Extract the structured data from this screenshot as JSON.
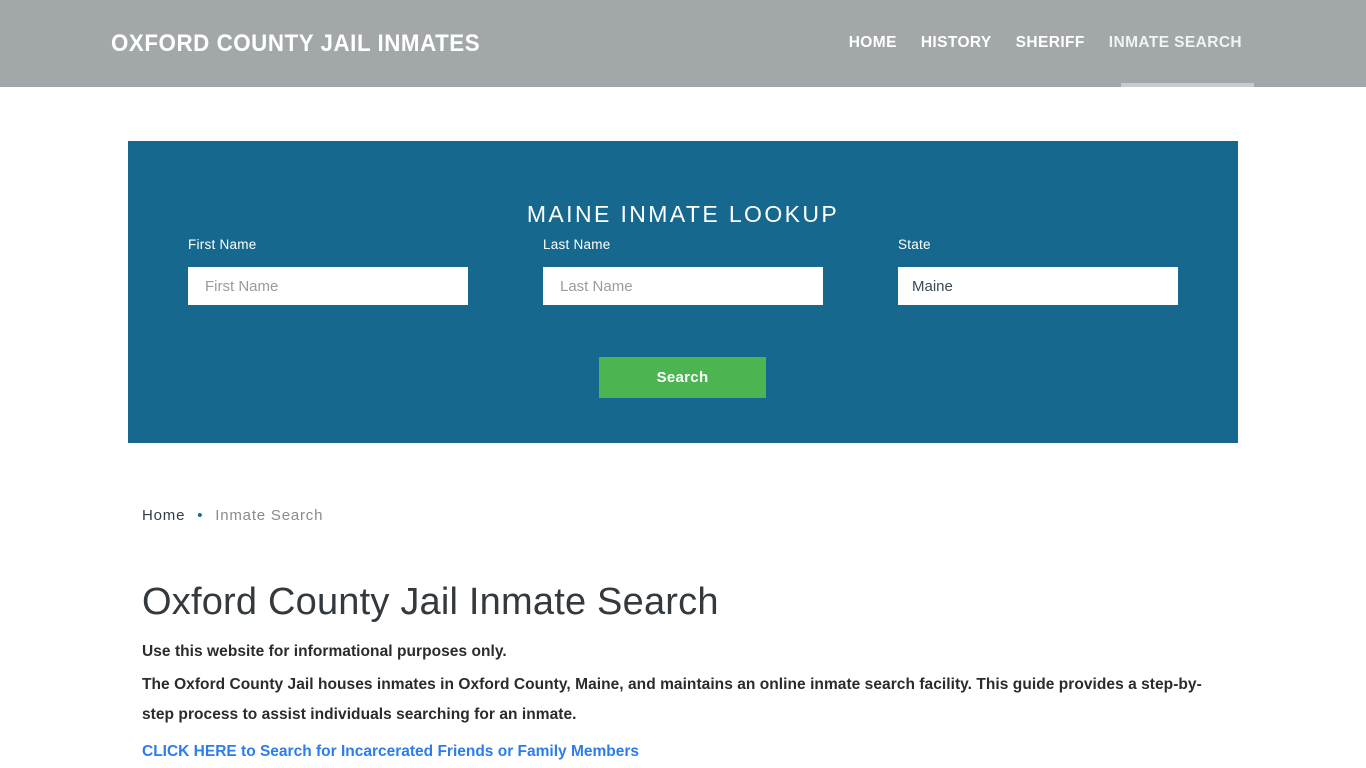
{
  "header": {
    "site_title": "OXFORD COUNTY JAIL INMATES",
    "nav": [
      {
        "label": "HOME",
        "active": false
      },
      {
        "label": "HISTORY",
        "active": false
      },
      {
        "label": "SHERIFF",
        "active": false
      },
      {
        "label": "INMATE SEARCH",
        "active": true
      }
    ],
    "background_color": "#a2a7aa",
    "text_color": "#ffffff",
    "active_indicator_color": "#c9ccce"
  },
  "lookup_panel": {
    "title": "MAINE INMATE LOOKUP",
    "background_color": "#16688f",
    "fields": {
      "first_name": {
        "label": "First Name",
        "placeholder": "First Name",
        "value": ""
      },
      "last_name": {
        "label": "Last Name",
        "placeholder": "Last Name",
        "value": ""
      },
      "state": {
        "label": "State",
        "value": "Maine",
        "options": [
          "Maine"
        ]
      }
    },
    "search_button": {
      "label": "Search",
      "color": "#4cb450"
    }
  },
  "breadcrumb": {
    "home_label": "Home",
    "separator": "•",
    "current_label": "Inmate Search",
    "separator_color": "#16688f"
  },
  "main": {
    "page_title": "Oxford County Jail Inmate Search",
    "paragraph_1": "Use this website for informational purposes only.",
    "paragraph_2": "The Oxford County Jail houses inmates in Oxford County, Maine, and maintains an online inmate search facility. This guide provides a step-by-step process to assist individuals searching for an inmate.",
    "cta_link": "CLICK HERE to Search for Incarcerated Friends or Family Members",
    "link_color": "#2b7cec"
  }
}
